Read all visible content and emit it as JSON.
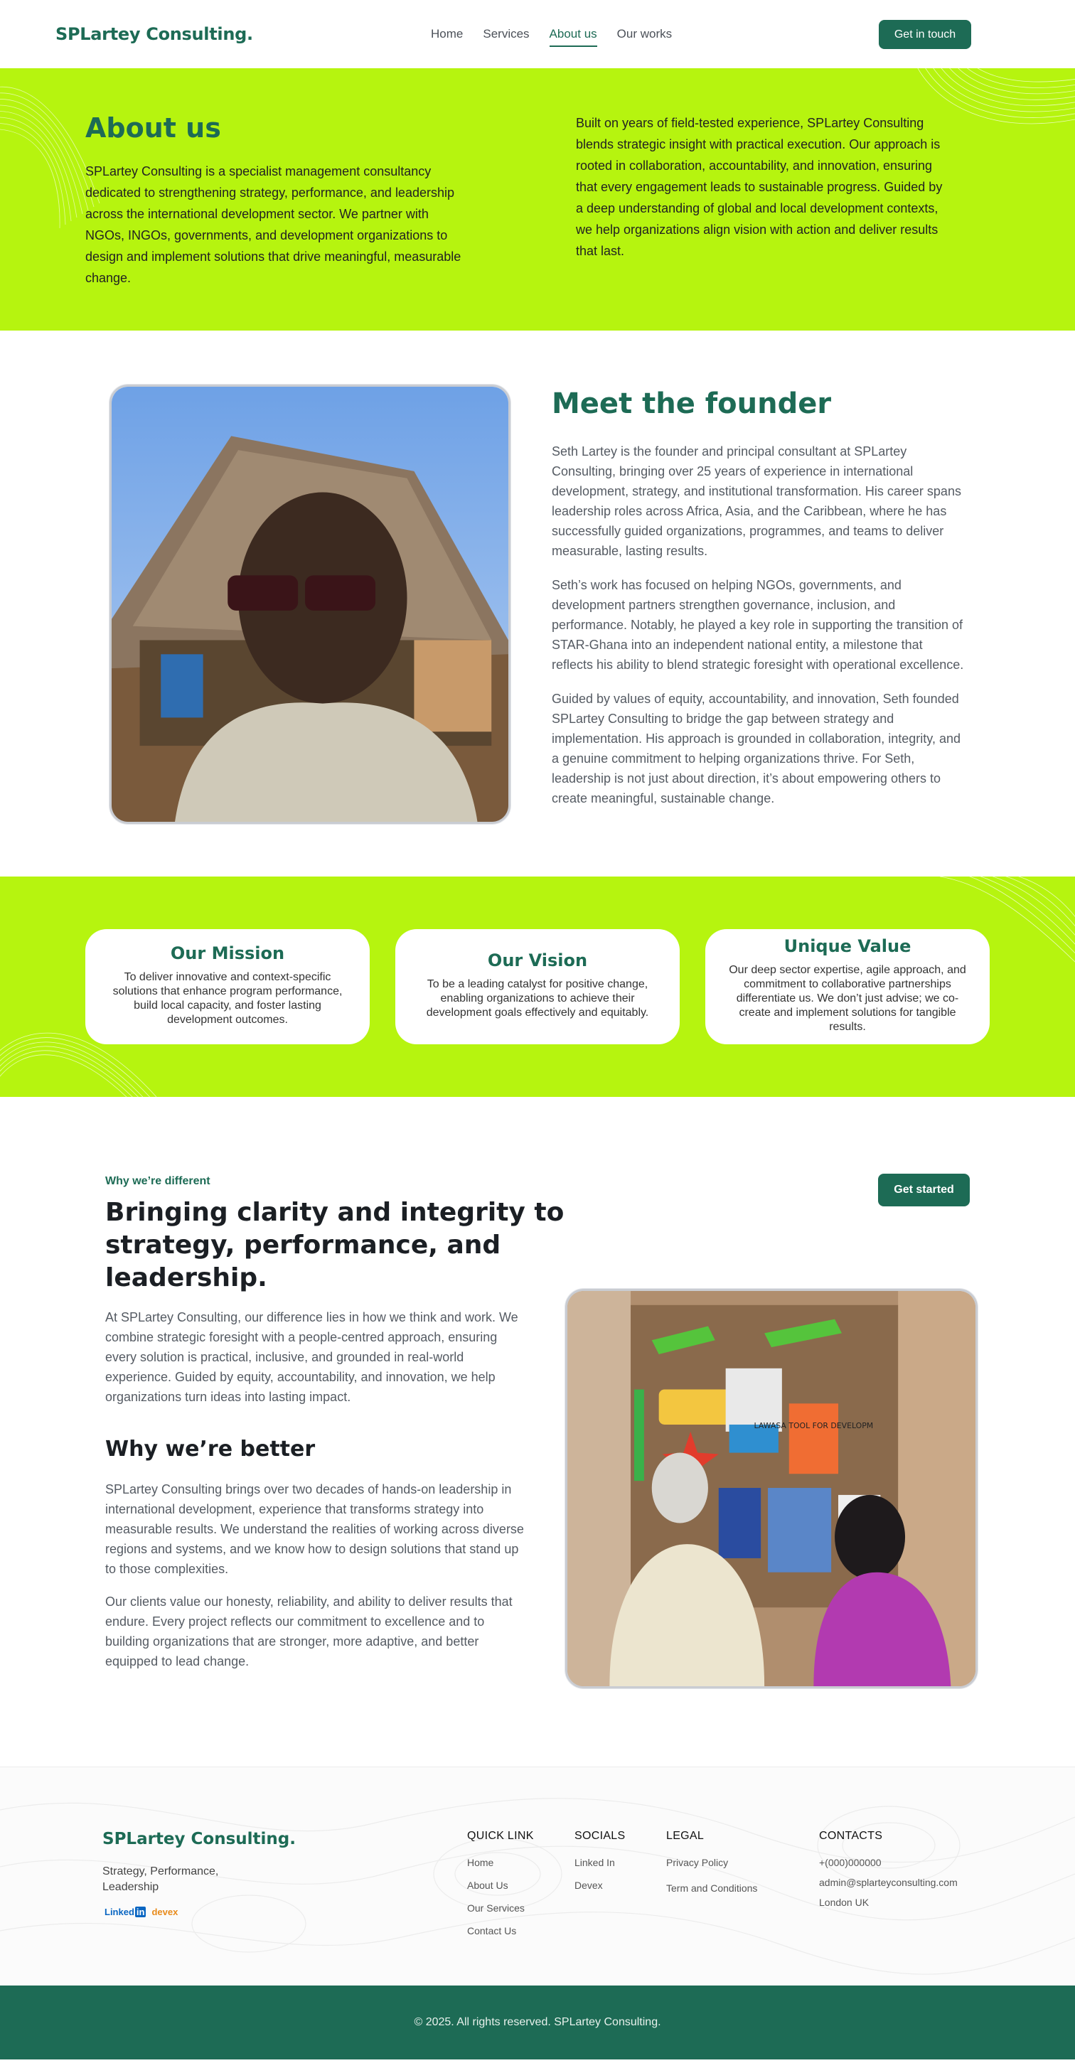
{
  "header": {
    "logo": "SPLartey Consulting.",
    "nav": [
      "Home",
      "Services",
      "About us",
      "Our works"
    ],
    "active_nav": "About us",
    "cta": "Get in touch"
  },
  "about": {
    "title": "About us",
    "left": "SPLartey Consulting is a specialist management consultancy dedicated to strengthening strategy, performance, and leadership across the international development sector. We partner with NGOs, INGOs, governments, and development organizations to design and implement solutions that drive meaningful, measurable change.",
    "right": "Built on years of field-tested experience, SPLartey Consulting blends strategic insight with practical execution. Our approach is rooted in collaboration, accountability, and innovation, ensuring that every engagement leads to sustainable progress. Guided by a deep understanding of global and local development contexts, we help organizations align vision with action and deliver results that last."
  },
  "founder": {
    "title": "Meet the founder",
    "paragraphs": [
      "Seth Lartey is the founder and principal consultant at SPLartey Consulting, bringing over 25 years of experience in international development, strategy, and institutional transformation. His career spans leadership roles across Africa, Asia, and the Caribbean, where he has successfully guided organizations, programmes, and teams to deliver measurable, lasting results.",
      "Seth’s work has focused on helping NGOs, governments, and development partners strengthen governance, inclusion, and performance. Notably, he played a key role in supporting the transition of STAR-Ghana into an independent national entity, a milestone that reflects his ability to blend strategic foresight with operational excellence.",
      "Guided by values of equity, accountability, and innovation, Seth founded SPLartey Consulting to bridge the gap between strategy and implementation. His approach is grounded in collaboration, integrity, and a genuine commitment to helping organizations thrive. For Seth, leadership is not just about direction, it’s about empowering others to create meaningful, sustainable change."
    ]
  },
  "values": [
    {
      "title": "Our Mission",
      "text": "To deliver innovative and context-specific solutions that enhance program performance, build local capacity, and foster lasting development outcomes."
    },
    {
      "title": "Our Vision",
      "text": "To be a leading catalyst for positive change, enabling organizations to achieve their development goals effectively and equitably."
    },
    {
      "title": "Unique Value",
      "text": "Our deep sector expertise, agile approach, and commitment to collaborative partnerships differentiate us. We don’t just advise; we co-create and implement solutions for tangible results."
    }
  ],
  "different": {
    "eyebrow": "Why we’re different",
    "title": "Bringing clarity and integrity to strategy, performance, and leadership.",
    "cta": "Get started",
    "intro": "At SPLartey Consulting, our difference lies in how we think and work. We combine strategic foresight with a people-centred approach, ensuring every solution is practical, inclusive, and grounded in real-world experience. Guided by equity, accountability, and innovation, we help organizations turn ideas into lasting impact.",
    "better_title": "Why we’re better",
    "better": [
      "SPLartey Consulting brings over two decades of hands-on leadership in international development, experience that transforms strategy into measurable results. We understand the realities of working across diverse regions and systems, and we know how to design solutions that stand up to those complexities.",
      "Our clients value our honesty, reliability, and ability to deliver results that endure. Every project reflects our commitment to excellence and to building organizations that are stronger, more adaptive, and better equipped to lead change."
    ],
    "board_text": "LAWASA TOOL FOR DEVELOPM"
  },
  "footer": {
    "logo": "SPLartey Consulting.",
    "tagline": "Strategy, Performance, Leadership",
    "linkedin": "Linked",
    "linkedin_in": "in",
    "devex": "devex",
    "quick_title": "QUICK LINK",
    "quick": [
      "Home",
      "About Us",
      "Our Services",
      "Contact Us"
    ],
    "socials_title": "SOCIALS",
    "socials": [
      "Linked In",
      "Devex"
    ],
    "legal_title": "LEGAL",
    "legal": [
      "Privacy Policy",
      "Term and Conditions"
    ],
    "contacts_title": "CONTACTS",
    "contacts": [
      "+(000)000000",
      "admin@splarteyconsulting.com",
      "London UK"
    ],
    "copyright": "© 2025. All rights reserved. SPLartey Consulting."
  },
  "colors": {
    "brand": "#1d6b55",
    "lime": "#b6f40f"
  }
}
